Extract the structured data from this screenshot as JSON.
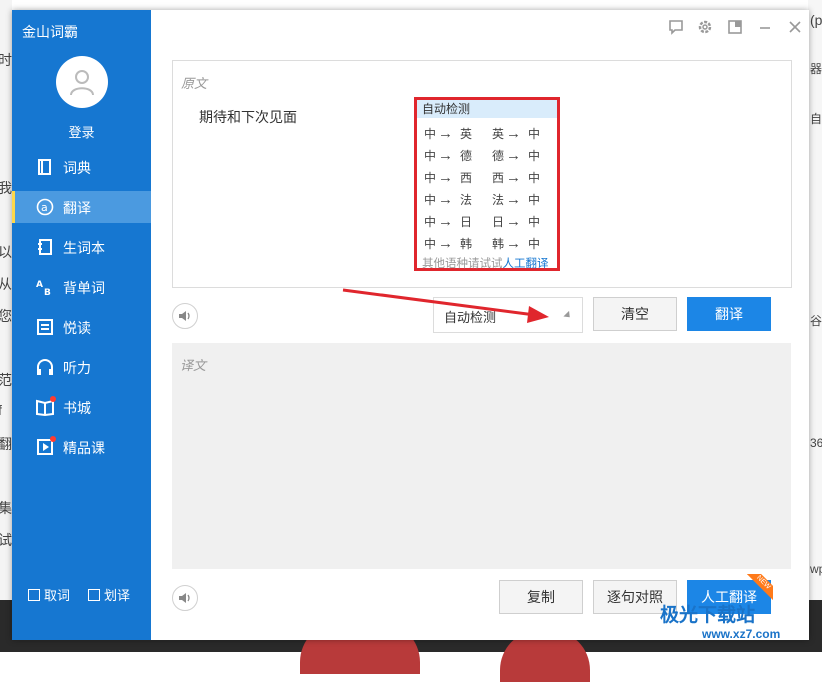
{
  "app": {
    "title": "金山词霸",
    "login": "登录"
  },
  "nav": [
    {
      "label": "词典",
      "icon": "dictionary-icon"
    },
    {
      "label": "翻译",
      "icon": "translate-icon",
      "active": true
    },
    {
      "label": "生词本",
      "icon": "wordbook-icon"
    },
    {
      "label": "背单词",
      "icon": "vocab-icon"
    },
    {
      "label": "悦读",
      "icon": "reading-icon"
    },
    {
      "label": "听力",
      "icon": "headphones-icon"
    },
    {
      "label": "书城",
      "icon": "bookstore-icon",
      "badge": true
    },
    {
      "label": "精品课",
      "icon": "course-icon",
      "badge": true
    }
  ],
  "footer_options": {
    "copy_word": "取词",
    "select_translate": "划译"
  },
  "source": {
    "placeholder": "原文",
    "text": "期待和下次见面"
  },
  "popup": {
    "header": "自动检测",
    "rows": [
      [
        "中",
        "英",
        "英",
        "中"
      ],
      [
        "中",
        "德",
        "德",
        "中"
      ],
      [
        "中",
        "西",
        "西",
        "中"
      ],
      [
        "中",
        "法",
        "法",
        "中"
      ],
      [
        "中",
        "日",
        "日",
        "中"
      ],
      [
        "中",
        "韩",
        "韩",
        "中"
      ]
    ],
    "arrow": "→",
    "footer_text": "其他语种请试试",
    "footer_link": "人工翻译"
  },
  "controls": {
    "language_select": "自动检测",
    "clear": "清空",
    "translate": "翻译"
  },
  "target": {
    "placeholder": "译文"
  },
  "bottom_buttons": {
    "copy": "复制",
    "sentence_compare": "逐句对照",
    "human_translate": "人工翻译",
    "new_badge": "NEW"
  },
  "background": {
    "left_fragments": [
      "时",
      "我",
      "以",
      "从",
      "您",
      "范",
      "f",
      "翻",
      "集",
      "试"
    ],
    "right_fragments": [
      "(p",
      "器",
      "自",
      "谷",
      "36",
      "wp"
    ]
  },
  "watermark": {
    "text": "极光下载站",
    "url": "www.xz7.com"
  },
  "colors": {
    "sidebar": "#1677d1",
    "primary": "#1c86e6",
    "highlight": "#e0262d",
    "active_marker": "#ffd84a"
  }
}
